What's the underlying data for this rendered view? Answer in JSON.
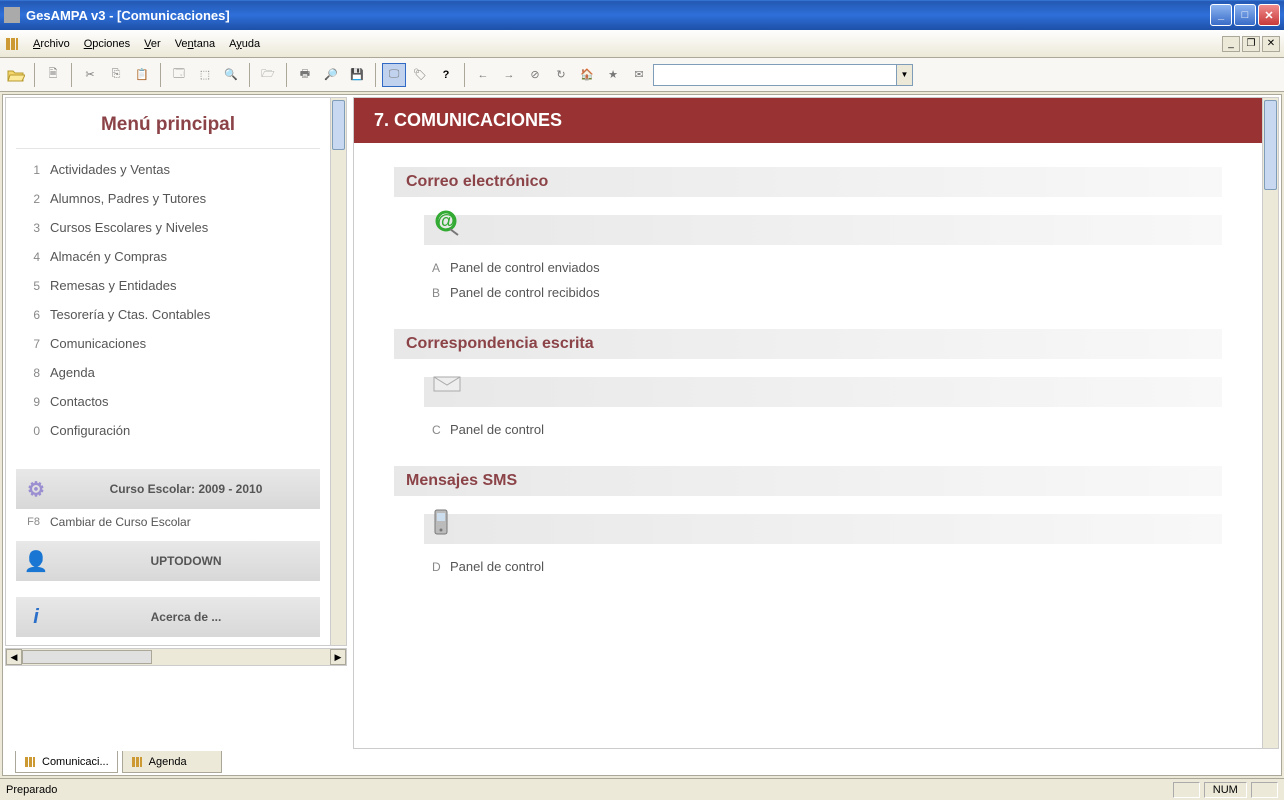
{
  "window": {
    "title": "GesAMPA v3 - [Comunicaciones]"
  },
  "menu": {
    "items": [
      "Archivo",
      "Opciones",
      "Ver",
      "Ventana",
      "Ayuda"
    ]
  },
  "sidebar": {
    "title": "Menú principal",
    "items": [
      {
        "num": "1",
        "label": "Actividades y Ventas"
      },
      {
        "num": "2",
        "label": "Alumnos, Padres y Tutores"
      },
      {
        "num": "3",
        "label": "Cursos Escolares y Niveles"
      },
      {
        "num": "4",
        "label": "Almacén y Compras"
      },
      {
        "num": "5",
        "label": "Remesas y Entidades"
      },
      {
        "num": "6",
        "label": "Tesorería y Ctas. Contables"
      },
      {
        "num": "7",
        "label": "Comunicaciones"
      },
      {
        "num": "8",
        "label": "Agenda"
      },
      {
        "num": "9",
        "label": "Contactos"
      },
      {
        "num": "0",
        "label": "Configuración"
      }
    ],
    "school_year_banner": "Curso Escolar: 2009 - 2010",
    "change_year": {
      "key": "F8",
      "label": "Cambiar de Curso Escolar"
    },
    "user_banner": "UPTODOWN",
    "about_banner": "Acerca de ..."
  },
  "content": {
    "header": "7.  COMUNICACIONES",
    "sections": [
      {
        "title": "Correo electrónico",
        "icon": "at",
        "items": [
          {
            "letter": "A",
            "label": "Panel de control enviados"
          },
          {
            "letter": "B",
            "label": "Panel de control recibidos"
          }
        ]
      },
      {
        "title": "Correspondencia escrita",
        "icon": "envelope",
        "items": [
          {
            "letter": "C",
            "label": "Panel de control"
          }
        ]
      },
      {
        "title": "Mensajes SMS",
        "icon": "phone",
        "items": [
          {
            "letter": "D",
            "label": "Panel de control"
          }
        ]
      }
    ]
  },
  "tabs": [
    {
      "label": "Comunicaci...",
      "active": true
    },
    {
      "label": "Agenda",
      "active": false
    }
  ],
  "status": {
    "text": "Preparado",
    "num": "NUM"
  }
}
